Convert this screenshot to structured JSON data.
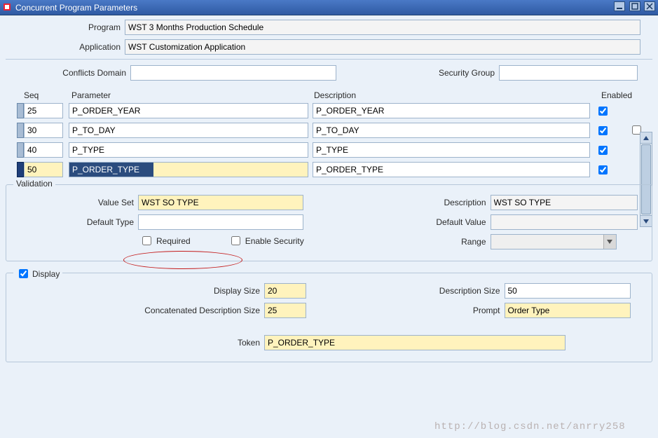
{
  "titlebar": {
    "title": "Concurrent Program Parameters"
  },
  "header": {
    "program_label": "Program",
    "program_value": "WST 3 Months Production Schedule",
    "application_label": "Application",
    "application_value": "WST Customization Application",
    "conflicts_label": "Conflicts Domain",
    "conflicts_value": "",
    "security_group_label": "Security Group",
    "security_group_value": ""
  },
  "grid": {
    "seq_header": "Seq",
    "param_header": "Parameter",
    "desc_header": "Description",
    "enabled_header": "Enabled",
    "rows": [
      {
        "seq": "25",
        "param": "P_ORDER_YEAR",
        "desc": "P_ORDER_YEAR",
        "enabled": true,
        "selected": false
      },
      {
        "seq": "30",
        "param": "P_TO_DAY",
        "desc": "P_TO_DAY",
        "enabled": true,
        "selected": false
      },
      {
        "seq": "40",
        "param": "P_TYPE",
        "desc": "P_TYPE",
        "enabled": true,
        "selected": false
      },
      {
        "seq": "50",
        "param": "P_ORDER_TYPE",
        "desc": "P_ORDER_TYPE",
        "enabled": true,
        "selected": true
      }
    ]
  },
  "validation": {
    "legend": "Validation",
    "value_set_label": "Value Set",
    "value_set_value": "WST SO TYPE",
    "default_type_label": "Default Type",
    "default_type_value": "",
    "required_label": "Required",
    "enable_security_label": "Enable Security",
    "description_label": "Description",
    "description_value": "WST SO TYPE",
    "default_value_label": "Default Value",
    "default_value_value": "",
    "range_label": "Range",
    "range_value": ""
  },
  "display": {
    "legend": "Display",
    "display_size_label": "Display Size",
    "display_size_value": "20",
    "concat_desc_label": "Concatenated Description Size",
    "concat_desc_value": "25",
    "desc_size_label": "Description Size",
    "desc_size_value": "50",
    "prompt_label": "Prompt",
    "prompt_value": "Order Type",
    "token_label": "Token",
    "token_value": "P_ORDER_TYPE"
  },
  "watermark": "http://blog.csdn.net/anrry258"
}
